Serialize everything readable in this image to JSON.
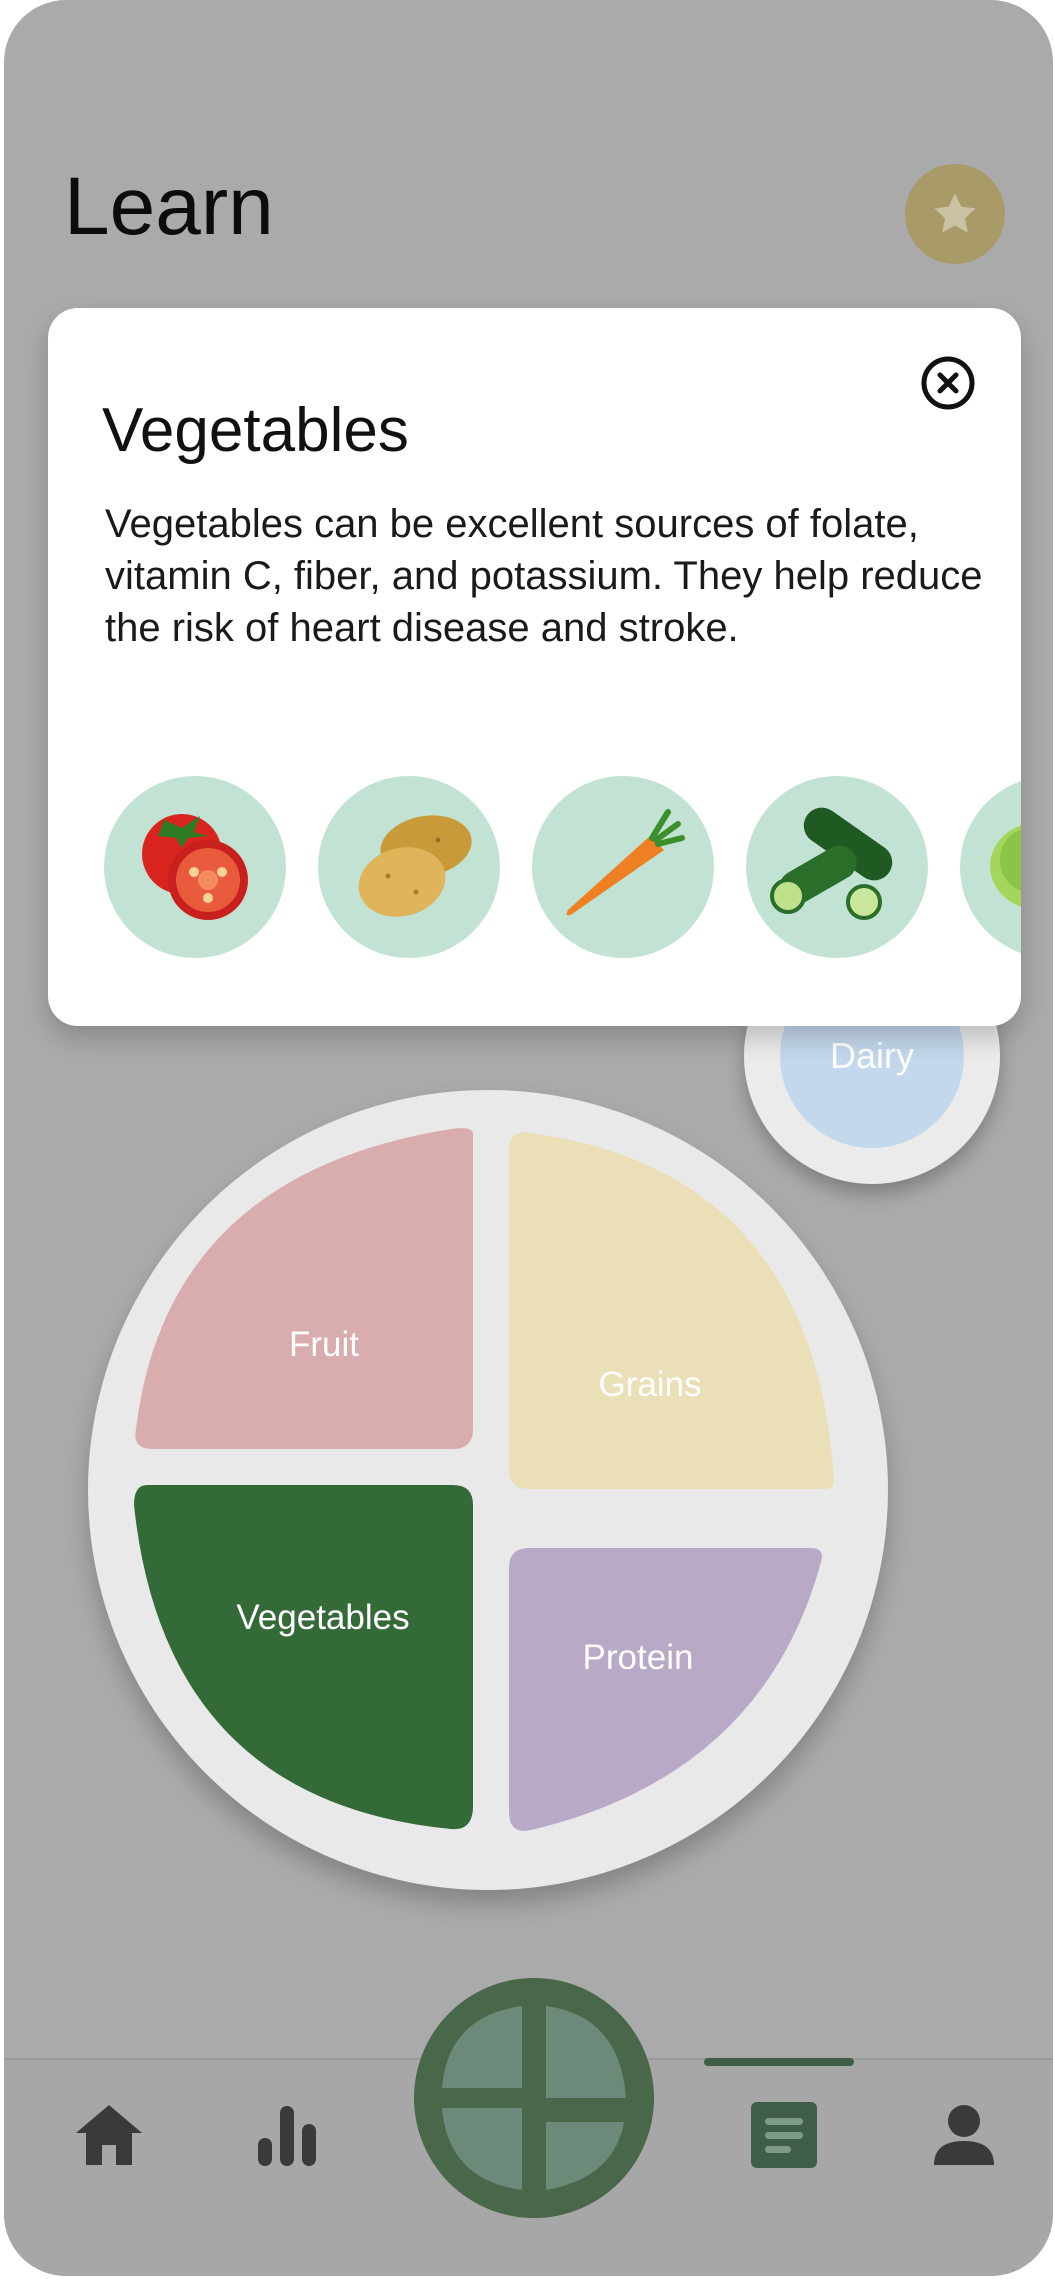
{
  "header": {
    "title": "Learn",
    "favorites_icon": "star-icon"
  },
  "modal": {
    "title": "Vegetables",
    "description": "Vegetables can be excellent sources of folate, vitamin C, fiber, and potassium. They help reduce the risk of heart disease and stroke.",
    "close_icon": "close-circle-icon",
    "items": [
      "tomato",
      "potato",
      "carrot",
      "cucumber",
      "lettuce"
    ]
  },
  "plate": {
    "fruit": "Fruit",
    "grains": "Grains",
    "vegetables": "Vegetables",
    "protein": "Protein",
    "dairy": "Dairy",
    "selected": "Vegetables"
  },
  "nav": {
    "items": [
      "home",
      "stats",
      "plate",
      "learn",
      "profile"
    ],
    "active": "learn"
  },
  "colors": {
    "fruit": "#d9adad",
    "grains": "#eadfb6",
    "vegetables": "#346a38",
    "protein": "#b8a9c6",
    "dairy": "#c3d8ec",
    "veg_bubble": "#c2e3d3",
    "star_button": "#a89b67"
  }
}
